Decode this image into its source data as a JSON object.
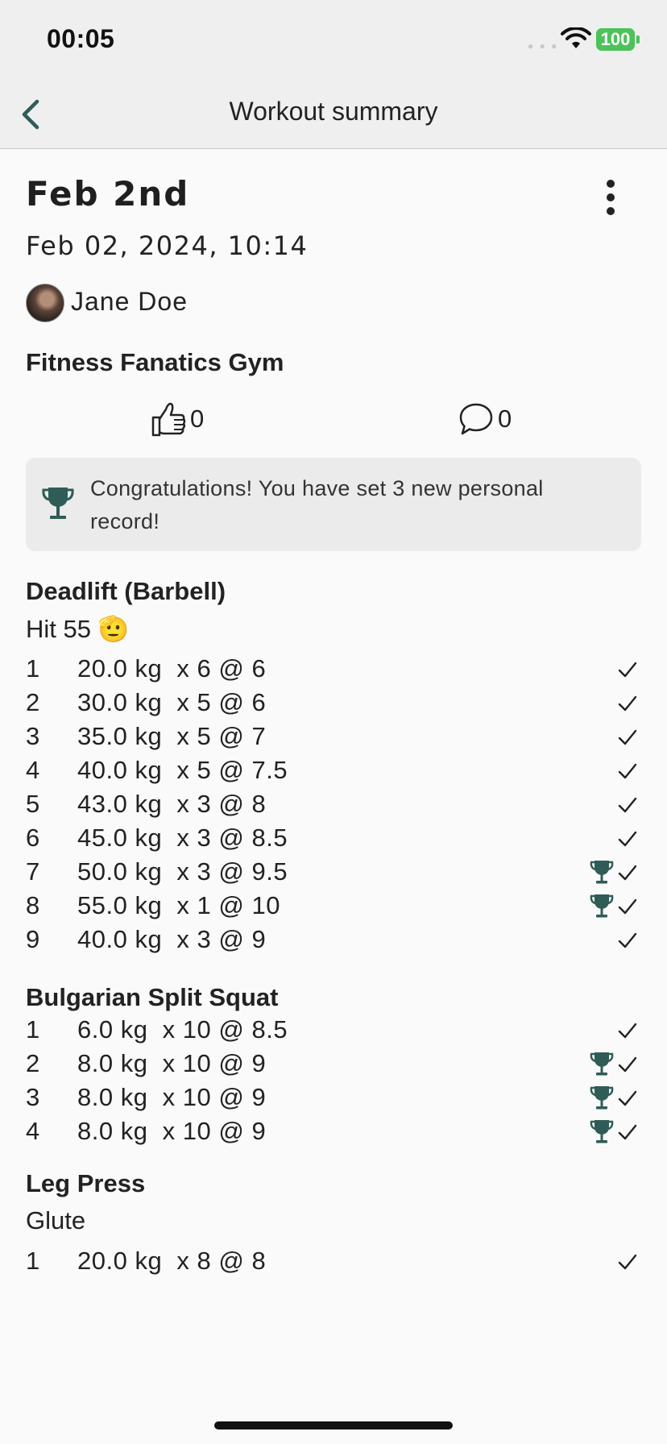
{
  "status_bar": {
    "time": "00:05",
    "battery": "100"
  },
  "nav": {
    "title": "Workout summary"
  },
  "workout": {
    "title": "Feb 2nd",
    "datetime": "Feb 02, 2024, 10:14",
    "user": "Jane Doe",
    "gym": "Fitness Fanatics Gym",
    "likes": "0",
    "comments": "0"
  },
  "pr_banner": {
    "text": "Congratulations! You have set 3 new personal record!"
  },
  "exercises": [
    {
      "name": "Deadlift (Barbell)",
      "note": "Hit 55 🫡",
      "sets": [
        {
          "num": "1",
          "detail": "20.0 kg  x 6 @ 6",
          "pr": false
        },
        {
          "num": "2",
          "detail": "30.0 kg  x 5 @ 6",
          "pr": false
        },
        {
          "num": "3",
          "detail": "35.0 kg  x 5 @ 7",
          "pr": false
        },
        {
          "num": "4",
          "detail": "40.0 kg  x 5 @ 7.5",
          "pr": false
        },
        {
          "num": "5",
          "detail": "43.0 kg  x 3 @ 8",
          "pr": false
        },
        {
          "num": "6",
          "detail": "45.0 kg  x 3 @ 8.5",
          "pr": false
        },
        {
          "num": "7",
          "detail": "50.0 kg  x 3 @ 9.5",
          "pr": true
        },
        {
          "num": "8",
          "detail": "55.0 kg  x 1 @ 10",
          "pr": true
        },
        {
          "num": "9",
          "detail": "40.0 kg  x 3 @ 9",
          "pr": false
        }
      ]
    },
    {
      "name": "Bulgarian Split Squat",
      "note": "",
      "sets": [
        {
          "num": "1",
          "detail": "6.0 kg  x 10 @ 8.5",
          "pr": false
        },
        {
          "num": "2",
          "detail": "8.0 kg  x 10 @ 9",
          "pr": true
        },
        {
          "num": "3",
          "detail": "8.0 kg  x 10 @ 9",
          "pr": true
        },
        {
          "num": "4",
          "detail": "8.0 kg  x 10 @ 9",
          "pr": true
        }
      ]
    },
    {
      "name": "Leg Press",
      "note": "Glute",
      "sets": [
        {
          "num": "1",
          "detail": "20.0 kg  x 8 @ 8",
          "pr": false
        }
      ]
    }
  ],
  "icons": {
    "back": "chevron-left-icon",
    "more": "more-vertical-icon",
    "like": "thumbs-up-icon",
    "comment": "comment-bubble-icon",
    "trophy": "trophy-icon",
    "check": "checkmark-icon"
  },
  "colors": {
    "accent": "#2f5c56",
    "battery": "#4cc35a",
    "banner_bg": "#ebebeb"
  }
}
